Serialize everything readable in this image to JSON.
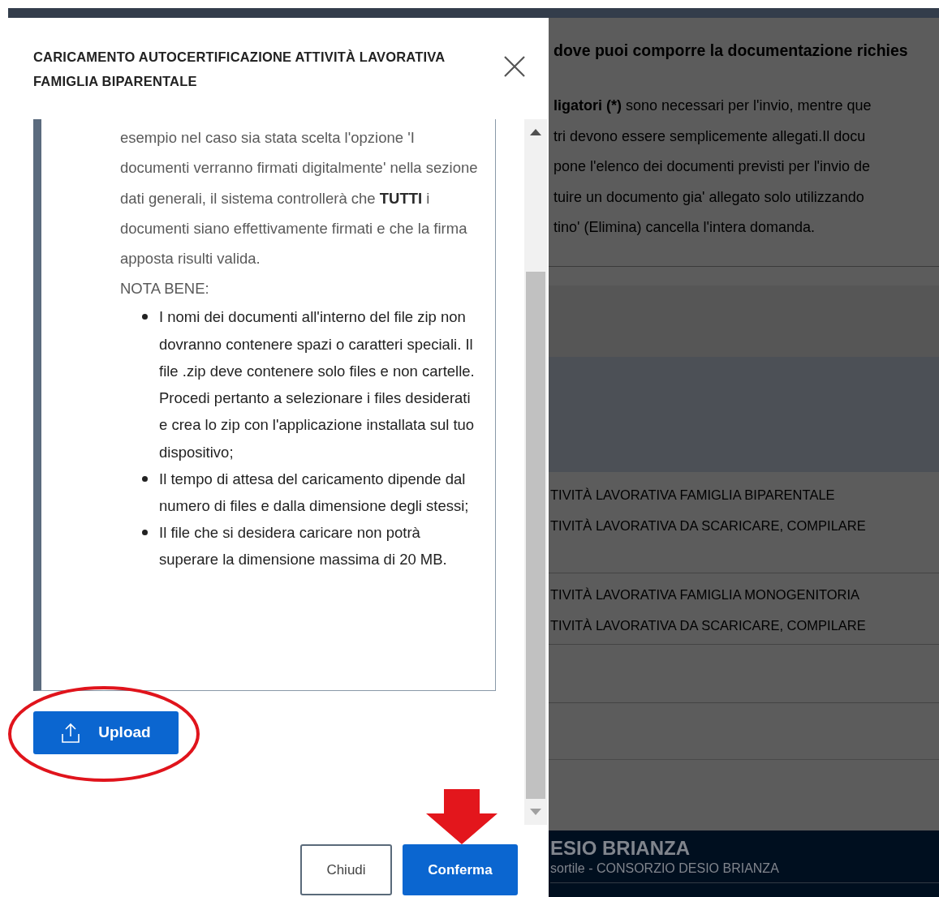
{
  "background": {
    "heading": "dove puoi comporre la documentazione richies",
    "paragraph_lines": [
      "**ligatori (*)** sono necessari per l'invio, mentre que",
      "tri devono essere semplicemente allegati.Il docu",
      "pone l'elenco dei documenti previsti per l'invio de",
      "tuire un documento gia' allegato solo utilizzando",
      "tino' (Elimina) cancella l'intera domanda."
    ],
    "document_rows": [
      {
        "lines": [
          "TIVITÀ LAVORATIVA FAMIGLIA BIPARENTALE",
          "TIVITÀ LAVORATIVA DA SCARICARE, COMPILARE"
        ]
      },
      {
        "lines": [
          "TIVITÀ LAVORATIVA FAMIGLIA MONOGENITORIA",
          "TIVITÀ LAVORATIVA DA SCARICARE, COMPILARE"
        ]
      }
    ],
    "footer": {
      "title": "ESIO BRIANZA",
      "subtitle": "sortile - CONSORZIO DESIO BRIANZA"
    }
  },
  "modal": {
    "title": "CARICAMENTO AUTOCERTIFICAZIONE ATTIVITÀ LAVORATIVA FAMIGLIA BIPARENTALE",
    "paragraph": "esempio nel caso sia stata scelta l'opzione 'I documenti verranno firmati digitalmente' nella sezione dati generali, il sistema controllerà che **TUTTI** i documenti siano effettivamente firmati e che la firma apposta risulti valida.",
    "note_label": "NOTA BENE:",
    "bullets": [
      "I nomi dei documenti all'interno del file zip non dovranno contenere spazi o caratteri speciali. Il file .zip deve contenere solo files e non cartelle. Procedi pertanto a selezionare i files desiderati e crea lo zip con l'applicazione installata sul tuo dispositivo;",
      "Il tempo di attesa del caricamento dipende dal numero di files e dalla dimensione degli stessi;",
      "Il file che si desidera caricare non potrà superare la dimensione massima di 20 MB."
    ],
    "upload_button": "Upload",
    "buttons": [
      {
        "label": "Chiudi",
        "kind": "secondary"
      },
      {
        "label": "Conferma",
        "kind": "primary"
      }
    ]
  }
}
